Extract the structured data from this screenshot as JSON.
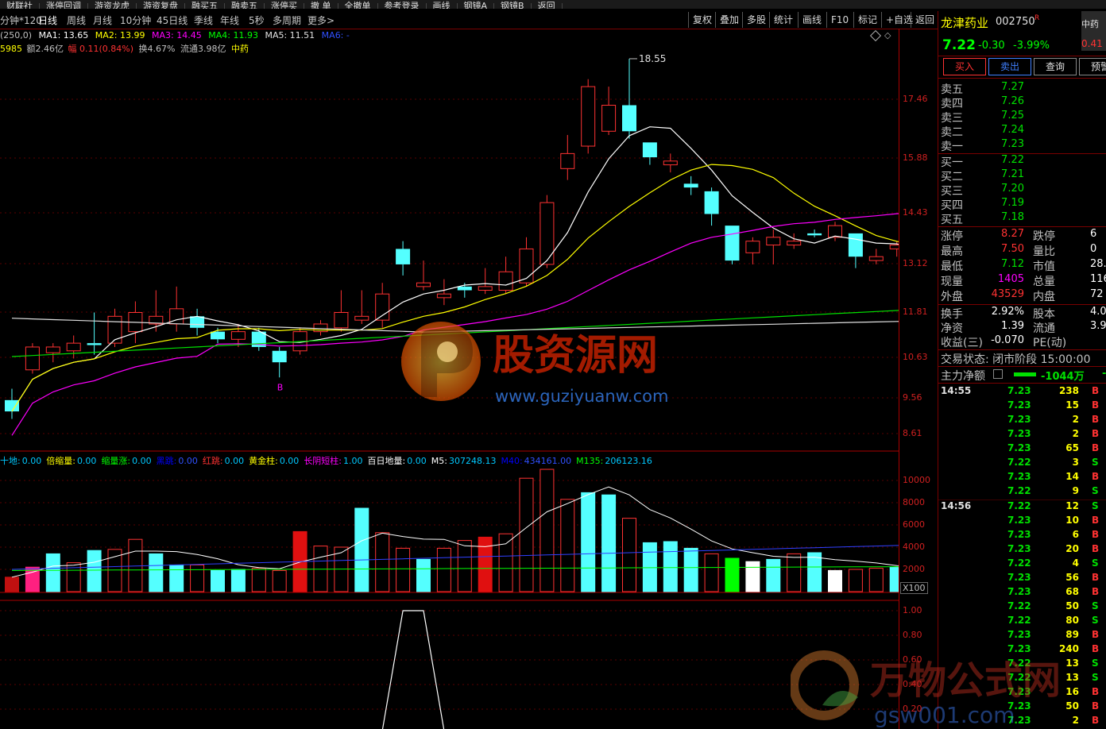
{
  "top_toolbar": [
    "财联社",
    "涨停回调",
    "游资龙虎",
    "游资复盘",
    "融买五",
    "融卖五",
    "涨停买",
    "撤 单",
    "全撤单",
    "参考登录",
    "画线",
    "钢镜A",
    "钢镜B",
    "返回"
  ],
  "periods": {
    "current": "分钟*120",
    "items": [
      "日线",
      "周线",
      "月线",
      "10分钟",
      "45日线",
      "季线",
      "年线",
      "5秒",
      "多周期",
      "更多>"
    ]
  },
  "right_buttons": [
    "复权",
    "叠加",
    "多股",
    "统计",
    "画线",
    "F10",
    "标记",
    "+自选",
    "返回"
  ],
  "ma_line": {
    "prefix": "(250,0)",
    "ma1": "MA1: 13.65",
    "ma2": "MA2: 13.99",
    "ma3": "MA3: 14.45",
    "ma4": "MA4: 11.93",
    "ma5": "MA5: 11.51",
    "ma6": "MA6: -"
  },
  "info_line": {
    "code": "5985",
    "amount": "额2.46亿",
    "amp_label": "幅",
    "amp": "0.11(0.84%)",
    "turnover": "换4.67%",
    "float": "流通3.98亿",
    "sector": "中药"
  },
  "price_ticks": [
    "17.46",
    "15.88",
    "14.43",
    "13.12",
    "11.81",
    "10.63",
    "9.56",
    "8.61"
  ],
  "high_label": "18.55",
  "signal_b": "B",
  "volume_indicator": {
    "items": [
      {
        "label": "十地:",
        "value": "0.00",
        "color": "#00c8ff"
      },
      {
        "label": "倍缩量:",
        "value": "0.00",
        "color": "#ffff00"
      },
      {
        "label": "缩量涨:",
        "value": "0.00",
        "color": "#00ff00"
      },
      {
        "label": "黑跳:",
        "value": "0.00",
        "color": "#0000ff"
      },
      {
        "label": "红跳:",
        "value": "0.00",
        "color": "#ff3232"
      },
      {
        "label": "黄金柱:",
        "value": "0.00",
        "color": "#ffff00"
      },
      {
        "label": "长阴短柱:",
        "value": "1.00",
        "color": "#ff00ff"
      },
      {
        "label": "百日地量:",
        "value": "0.00",
        "color": "#ffffff"
      },
      {
        "label": "M5:",
        "value": "307248.13",
        "color": "#ffffff"
      },
      {
        "label": "M40:",
        "value": "434161.00",
        "color": "#0000ff"
      },
      {
        "label": "M135:",
        "value": "206123.16",
        "color": "#00ff00"
      }
    ],
    "ticks": [
      "10000",
      "8000",
      "6000",
      "4000",
      "2000"
    ],
    "scale": "X100"
  },
  "lower_ticks": [
    "1.00",
    "0.80",
    "0.60",
    "0.40",
    "0.20"
  ],
  "quote": {
    "name": "龙津药业",
    "code": "002750",
    "r_tag": "R",
    "corner": "中药",
    "price": "7.22",
    "change": "-0.30",
    "pct": "-3.99%",
    "corner_val": "0.41",
    "buttons": [
      "买入",
      "卖出",
      "查询",
      "预警"
    ],
    "asks": [
      {
        "label": "卖五",
        "price": "7.27"
      },
      {
        "label": "卖四",
        "price": "7.26"
      },
      {
        "label": "卖三",
        "price": "7.25"
      },
      {
        "label": "卖二",
        "price": "7.24"
      },
      {
        "label": "卖一",
        "price": "7.23"
      }
    ],
    "bids": [
      {
        "label": "买一",
        "price": "7.22"
      },
      {
        "label": "买二",
        "price": "7.21"
      },
      {
        "label": "买三",
        "price": "7.20"
      },
      {
        "label": "买四",
        "price": "7.19"
      },
      {
        "label": "买五",
        "price": "7.18"
      }
    ],
    "stats": [
      {
        "l1": "涨停",
        "v1": "8.27",
        "c1": "red",
        "l2": "跌停",
        "v2": "6"
      },
      {
        "l1": "最高",
        "v1": "7.50",
        "c1": "red",
        "l2": "量比",
        "v2": "0"
      },
      {
        "l1": "最低",
        "v1": "7.12",
        "c1": "green",
        "l2": "市值",
        "v2": "28."
      },
      {
        "l1": "现量",
        "v1": "1405",
        "c1": "magenta",
        "l2": "总量",
        "v2": "116"
      },
      {
        "l1": "外盘",
        "v1": "43529",
        "c1": "red",
        "l2": "内盘",
        "v2": "72"
      }
    ],
    "fund": [
      {
        "l1": "换手",
        "v1": "2.92%",
        "l2": "股本",
        "v2": "4.0"
      },
      {
        "l1": "净资",
        "v1": "1.39",
        "l2": "流通",
        "v2": "3.9"
      },
      {
        "l1": "收益(三)",
        "v1": "-0.070",
        "l2": "PE(动)",
        "v2": ""
      }
    ],
    "trade_state": "交易状态: 闭市阶段 15:00:00",
    "main_net_label": "主力净额",
    "main_net_value": "-1044万",
    "main_net_tail": "-1"
  },
  "ticks_list": [
    {
      "t": "14:55",
      "p": "7.23",
      "v": "238",
      "bs": "B"
    },
    {
      "t": "",
      "p": "7.23",
      "v": "15",
      "bs": "B"
    },
    {
      "t": "",
      "p": "7.23",
      "v": "2",
      "bs": "B"
    },
    {
      "t": "",
      "p": "7.23",
      "v": "2",
      "bs": "B"
    },
    {
      "t": "",
      "p": "7.23",
      "v": "65",
      "bs": "B"
    },
    {
      "t": "",
      "p": "7.22",
      "v": "3",
      "bs": "S"
    },
    {
      "t": "",
      "p": "7.23",
      "v": "14",
      "bs": "B"
    },
    {
      "t": "",
      "p": "7.22",
      "v": "9",
      "bs": "S"
    },
    {
      "t": "14:56",
      "p": "7.22",
      "v": "12",
      "bs": "S"
    },
    {
      "t": "",
      "p": "7.23",
      "v": "10",
      "bs": "B"
    },
    {
      "t": "",
      "p": "7.23",
      "v": "6",
      "bs": "B"
    },
    {
      "t": "",
      "p": "7.23",
      "v": "20",
      "bs": "B"
    },
    {
      "t": "",
      "p": "7.22",
      "v": "4",
      "bs": "S"
    },
    {
      "t": "",
      "p": "7.23",
      "v": "56",
      "bs": "B"
    },
    {
      "t": "",
      "p": "7.23",
      "v": "68",
      "bs": "B"
    },
    {
      "t": "",
      "p": "7.22",
      "v": "50",
      "bs": "S"
    },
    {
      "t": "",
      "p": "7.22",
      "v": "80",
      "bs": "S"
    },
    {
      "t": "",
      "p": "7.23",
      "v": "89",
      "bs": "B"
    },
    {
      "t": "",
      "p": "7.23",
      "v": "240",
      "bs": "B"
    },
    {
      "t": "",
      "p": "7.22",
      "v": "13",
      "bs": "S"
    },
    {
      "t": "",
      "p": "7.22",
      "v": "13",
      "bs": "S"
    },
    {
      "t": "",
      "p": "7.23",
      "v": "16",
      "bs": "B"
    },
    {
      "t": "",
      "p": "7.23",
      "v": "50",
      "bs": "B"
    },
    {
      "t": "",
      "p": "7.23",
      "v": "2",
      "bs": "B"
    }
  ],
  "watermarks": {
    "wm1_title": "股资源网",
    "wm1_url": "www.guziyuanw.com",
    "wm2_title": "万物公式网",
    "wm2_url": "gsw001.com"
  },
  "candles": [
    {
      "o": 9.5,
      "c": 9.2,
      "h": 9.8,
      "l": 9.0
    },
    {
      "o": 10.3,
      "c": 10.9,
      "h": 11.0,
      "l": 10.2
    },
    {
      "o": 10.75,
      "c": 10.9,
      "h": 11.0,
      "l": 10.5
    },
    {
      "o": 10.8,
      "c": 11.0,
      "h": 11.2,
      "l": 10.6
    },
    {
      "o": 11.0,
      "c": 10.95,
      "h": 11.8,
      "l": 10.7
    },
    {
      "o": 11.0,
      "c": 11.7,
      "h": 11.9,
      "l": 10.9
    },
    {
      "o": 11.3,
      "c": 11.8,
      "h": 12.1,
      "l": 11.0
    },
    {
      "o": 11.5,
      "c": 11.7,
      "h": 12.4,
      "l": 11.3
    },
    {
      "o": 11.5,
      "c": 11.9,
      "h": 12.5,
      "l": 11.3
    },
    {
      "o": 11.7,
      "c": 11.4,
      "h": 11.9,
      "l": 11.2
    },
    {
      "o": 11.3,
      "c": 11.1,
      "h": 11.4,
      "l": 11.0
    },
    {
      "o": 11.1,
      "c": 11.3,
      "h": 11.5,
      "l": 10.9
    },
    {
      "o": 11.3,
      "c": 10.9,
      "h": 11.4,
      "l": 10.8
    },
    {
      "o": 10.8,
      "c": 10.5,
      "h": 10.9,
      "l": 10.1
    },
    {
      "o": 10.8,
      "c": 11.3,
      "h": 11.4,
      "l": 10.7
    },
    {
      "o": 11.3,
      "c": 11.5,
      "h": 11.6,
      "l": 11.2
    },
    {
      "o": 11.4,
      "c": 11.8,
      "h": 12.4,
      "l": 11.3
    },
    {
      "o": 11.6,
      "c": 11.7,
      "h": 12.4,
      "l": 11.5
    },
    {
      "o": 11.6,
      "c": 12.3,
      "h": 12.6,
      "l": 11.4
    },
    {
      "o": 13.5,
      "c": 13.1,
      "h": 13.7,
      "l": 12.8
    },
    {
      "o": 12.5,
      "c": 12.6,
      "h": 13.2,
      "l": 12.4
    },
    {
      "o": 12.2,
      "c": 12.3,
      "h": 12.7,
      "l": 12.0
    },
    {
      "o": 12.5,
      "c": 12.4,
      "h": 12.6,
      "l": 12.2
    },
    {
      "o": 12.4,
      "c": 12.5,
      "h": 13.0,
      "l": 12.3
    },
    {
      "o": 12.4,
      "c": 12.9,
      "h": 13.3,
      "l": 12.3
    },
    {
      "o": 12.6,
      "c": 13.5,
      "h": 13.8,
      "l": 12.5
    },
    {
      "o": 13.1,
      "c": 14.7,
      "h": 14.9,
      "l": 13.0
    },
    {
      "o": 15.6,
      "c": 16.0,
      "h": 16.5,
      "l": 15.3
    },
    {
      "o": 16.2,
      "c": 17.8,
      "h": 18.0,
      "l": 16.0
    },
    {
      "o": 16.6,
      "c": 17.3,
      "h": 17.8,
      "l": 16.5
    },
    {
      "o": 17.3,
      "c": 16.6,
      "h": 18.55,
      "l": 16.4
    },
    {
      "o": 16.3,
      "c": 15.9,
      "h": 16.3,
      "l": 15.7
    },
    {
      "o": 15.7,
      "c": 15.8,
      "h": 16.0,
      "l": 15.5
    },
    {
      "o": 15.2,
      "c": 15.1,
      "h": 15.4,
      "l": 14.9
    },
    {
      "o": 15.0,
      "c": 14.4,
      "h": 15.1,
      "l": 14.1
    },
    {
      "o": 14.1,
      "c": 13.2,
      "h": 14.1,
      "l": 13.1
    },
    {
      "o": 13.4,
      "c": 13.7,
      "h": 13.8,
      "l": 13.1
    },
    {
      "o": 13.6,
      "c": 13.8,
      "h": 14.0,
      "l": 13.1
    },
    {
      "o": 13.6,
      "c": 13.7,
      "h": 13.9,
      "l": 13.5
    },
    {
      "o": 13.9,
      "c": 13.85,
      "h": 14.0,
      "l": 13.8
    },
    {
      "o": 13.8,
      "c": 14.1,
      "h": 14.2,
      "l": 13.7
    },
    {
      "o": 13.9,
      "c": 13.3,
      "h": 13.9,
      "l": 13.0
    },
    {
      "o": 13.2,
      "c": 13.3,
      "h": 13.5,
      "l": 13.1
    },
    {
      "o": 13.5,
      "c": 13.6,
      "h": 13.7,
      "l": 13.3
    },
    {
      "o": 13.5,
      "c": 13.3,
      "h": 13.6,
      "l": 13.2
    },
    {
      "o": 13.4,
      "c": 13.6,
      "h": 13.7,
      "l": 12.8
    }
  ],
  "volumes": [
    {
      "v": 1300,
      "c": "darkred"
    },
    {
      "v": 2200,
      "c": "pink"
    },
    {
      "v": 3400,
      "c": "cyan"
    },
    {
      "v": 2600,
      "c": "up"
    },
    {
      "v": 3700,
      "c": "cyan"
    },
    {
      "v": 3800,
      "c": "up"
    },
    {
      "v": 4700,
      "c": "up"
    },
    {
      "v": 3400,
      "c": "cyan"
    },
    {
      "v": 2400,
      "c": "cyan"
    },
    {
      "v": 2400,
      "c": "up"
    },
    {
      "v": 1900,
      "c": "cyan"
    },
    {
      "v": 2000,
      "c": "cyan"
    },
    {
      "v": 2100,
      "c": "up"
    },
    {
      "v": 1900,
      "c": "up"
    },
    {
      "v": 5400,
      "c": "redfill"
    },
    {
      "v": 4100,
      "c": "up"
    },
    {
      "v": 4000,
      "c": "up"
    },
    {
      "v": 7500,
      "c": "cyan"
    },
    {
      "v": 5300,
      "c": "up"
    },
    {
      "v": 3900,
      "c": "up"
    },
    {
      "v": 2900,
      "c": "cyan"
    },
    {
      "v": 3900,
      "c": "up"
    },
    {
      "v": 4600,
      "c": "up"
    },
    {
      "v": 4900,
      "c": "redfill"
    },
    {
      "v": 5200,
      "c": "up"
    },
    {
      "v": 10200,
      "c": "up"
    },
    {
      "v": 11000,
      "c": "up"
    },
    {
      "v": 8300,
      "c": "up"
    },
    {
      "v": 8900,
      "c": "cyan"
    },
    {
      "v": 8700,
      "c": "cyan"
    },
    {
      "v": 6600,
      "c": "up"
    },
    {
      "v": 4400,
      "c": "cyan"
    },
    {
      "v": 4500,
      "c": "cyan"
    },
    {
      "v": 3900,
      "c": "cyan"
    },
    {
      "v": 3400,
      "c": "up"
    },
    {
      "v": 3000,
      "c": "green"
    },
    {
      "v": 2700,
      "c": "white"
    },
    {
      "v": 2900,
      "c": "cyan"
    },
    {
      "v": 3400,
      "c": "up"
    },
    {
      "v": 3500,
      "c": "cyan"
    },
    {
      "v": 1900,
      "c": "white"
    },
    {
      "v": 2000,
      "c": "up"
    },
    {
      "v": 2100,
      "c": "up"
    },
    {
      "v": 2200,
      "c": "cyan"
    },
    {
      "v": 2800,
      "c": "redfill"
    }
  ],
  "lower_signal": [
    0,
    0,
    0,
    0,
    0,
    0,
    0,
    0,
    0,
    0,
    0,
    0,
    0,
    0,
    0,
    0,
    0,
    0,
    0,
    1,
    1,
    0,
    0,
    0,
    0,
    0,
    0,
    0,
    0,
    0,
    0,
    0,
    0,
    0,
    0,
    0,
    0,
    0,
    0,
    0,
    0,
    0,
    0,
    0,
    0,
    0
  ]
}
